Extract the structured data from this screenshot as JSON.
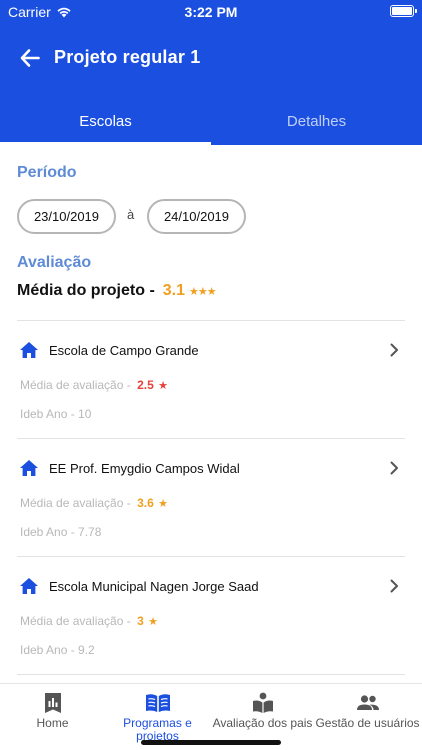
{
  "status_bar": {
    "carrier": "Carrier",
    "time": "3:22 PM"
  },
  "appbar": {
    "title": "Projeto regular 1"
  },
  "tabs": [
    {
      "label": "Escolas",
      "active": true
    },
    {
      "label": "Detalhes",
      "active": false
    }
  ],
  "periodo": {
    "label": "Período",
    "start_date": "23/10/2019",
    "separator": "à",
    "end_date": "24/10/2019"
  },
  "avaliacao": {
    "label": "Avaliação",
    "media_label": "Média do projeto -",
    "media_value": "3.1",
    "media_stars": "★★★"
  },
  "schools": [
    {
      "name": "Escola de Campo Grande",
      "rating_label": "Média de avaliação -",
      "rating_value": "2.5",
      "rating_color": "#e8403a",
      "ideb": "Ideb Ano - 10"
    },
    {
      "name": "EE Prof. Emygdio Campos Widal",
      "rating_label": "Média de avaliação -",
      "rating_value": "3.6",
      "rating_color": "#f0a020",
      "ideb": "Ideb Ano - 7.78"
    },
    {
      "name": "Escola Municipal Nagen Jorge Saad",
      "rating_label": "Média de avaliação -",
      "rating_value": "3",
      "rating_color": "#f0a020",
      "ideb": "Ideb Ano - 9.2"
    }
  ],
  "bottom_nav": [
    {
      "label": "Home",
      "icon": "chart-book-icon",
      "active": false
    },
    {
      "label": "Programas e projetos",
      "icon": "open-book-icon",
      "active": true
    },
    {
      "label": "Avaliação dos pais",
      "icon": "book-person-icon",
      "active": false
    },
    {
      "label": "Gestão de usuários",
      "icon": "users-icon",
      "active": false
    }
  ],
  "colors": {
    "brand": "#1b4fe0",
    "section_label": "#5f8bd6",
    "star": "#f0a020",
    "low_rating": "#e8403a"
  }
}
